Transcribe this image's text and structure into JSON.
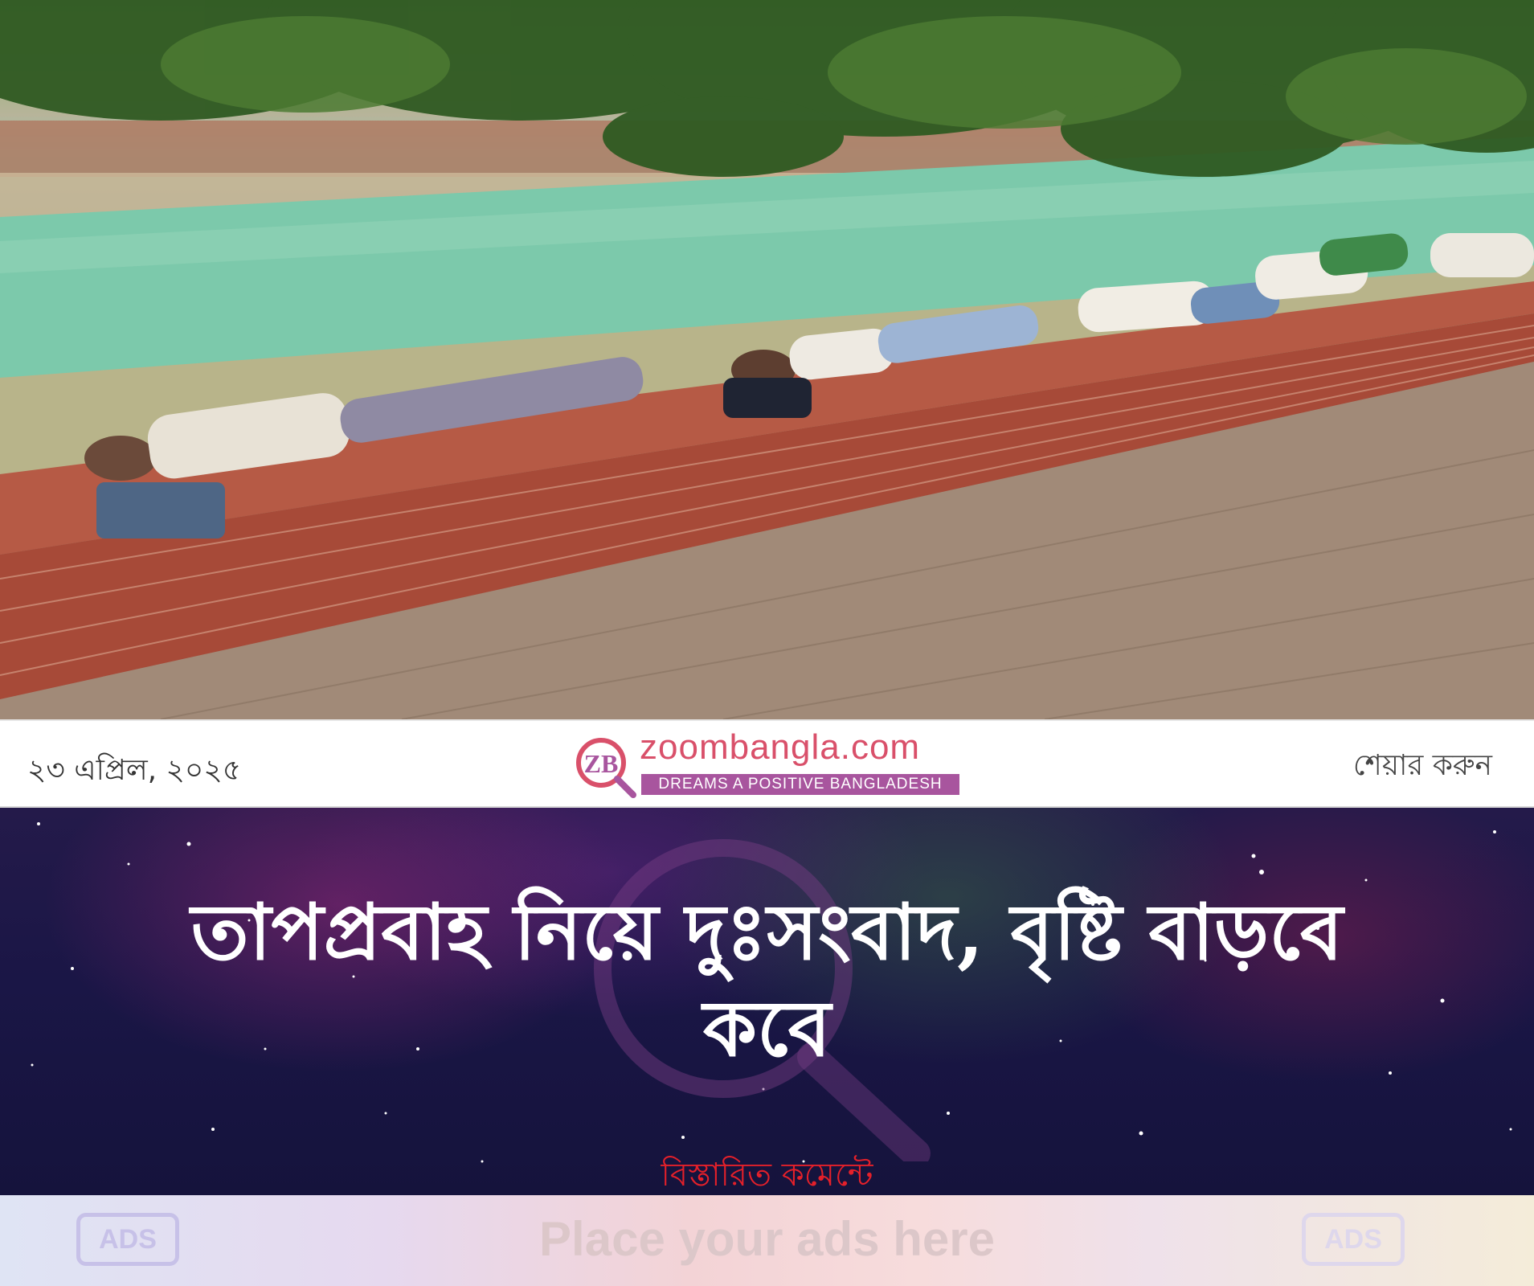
{
  "header": {
    "date": "২৩ এপ্রিল, ২০২৫",
    "share_label": "শেয়ার করুন",
    "logo_name": "zoombangla.com",
    "logo_tagline": "DREAMS A POSITIVE  BANGLADESH",
    "logo_mark": "ZB",
    "brand_color": "#d9506a",
    "tagline_bg": "#a8559e"
  },
  "headline": {
    "line1": "তাপপ্রবাহ নিয়ে দুঃসংবাদ, বৃষ্টি বাড়বে",
    "line2": "কবে",
    "details_label": "বিস্তারিত কমেন্টে",
    "details_color": "#e4202a"
  },
  "ads": {
    "text": "Place your ads here",
    "badge_left": "ADS",
    "badge_right": "ADS"
  },
  "photo": {
    "icon": "news-photo-people-sleeping-on-brick-wall"
  }
}
